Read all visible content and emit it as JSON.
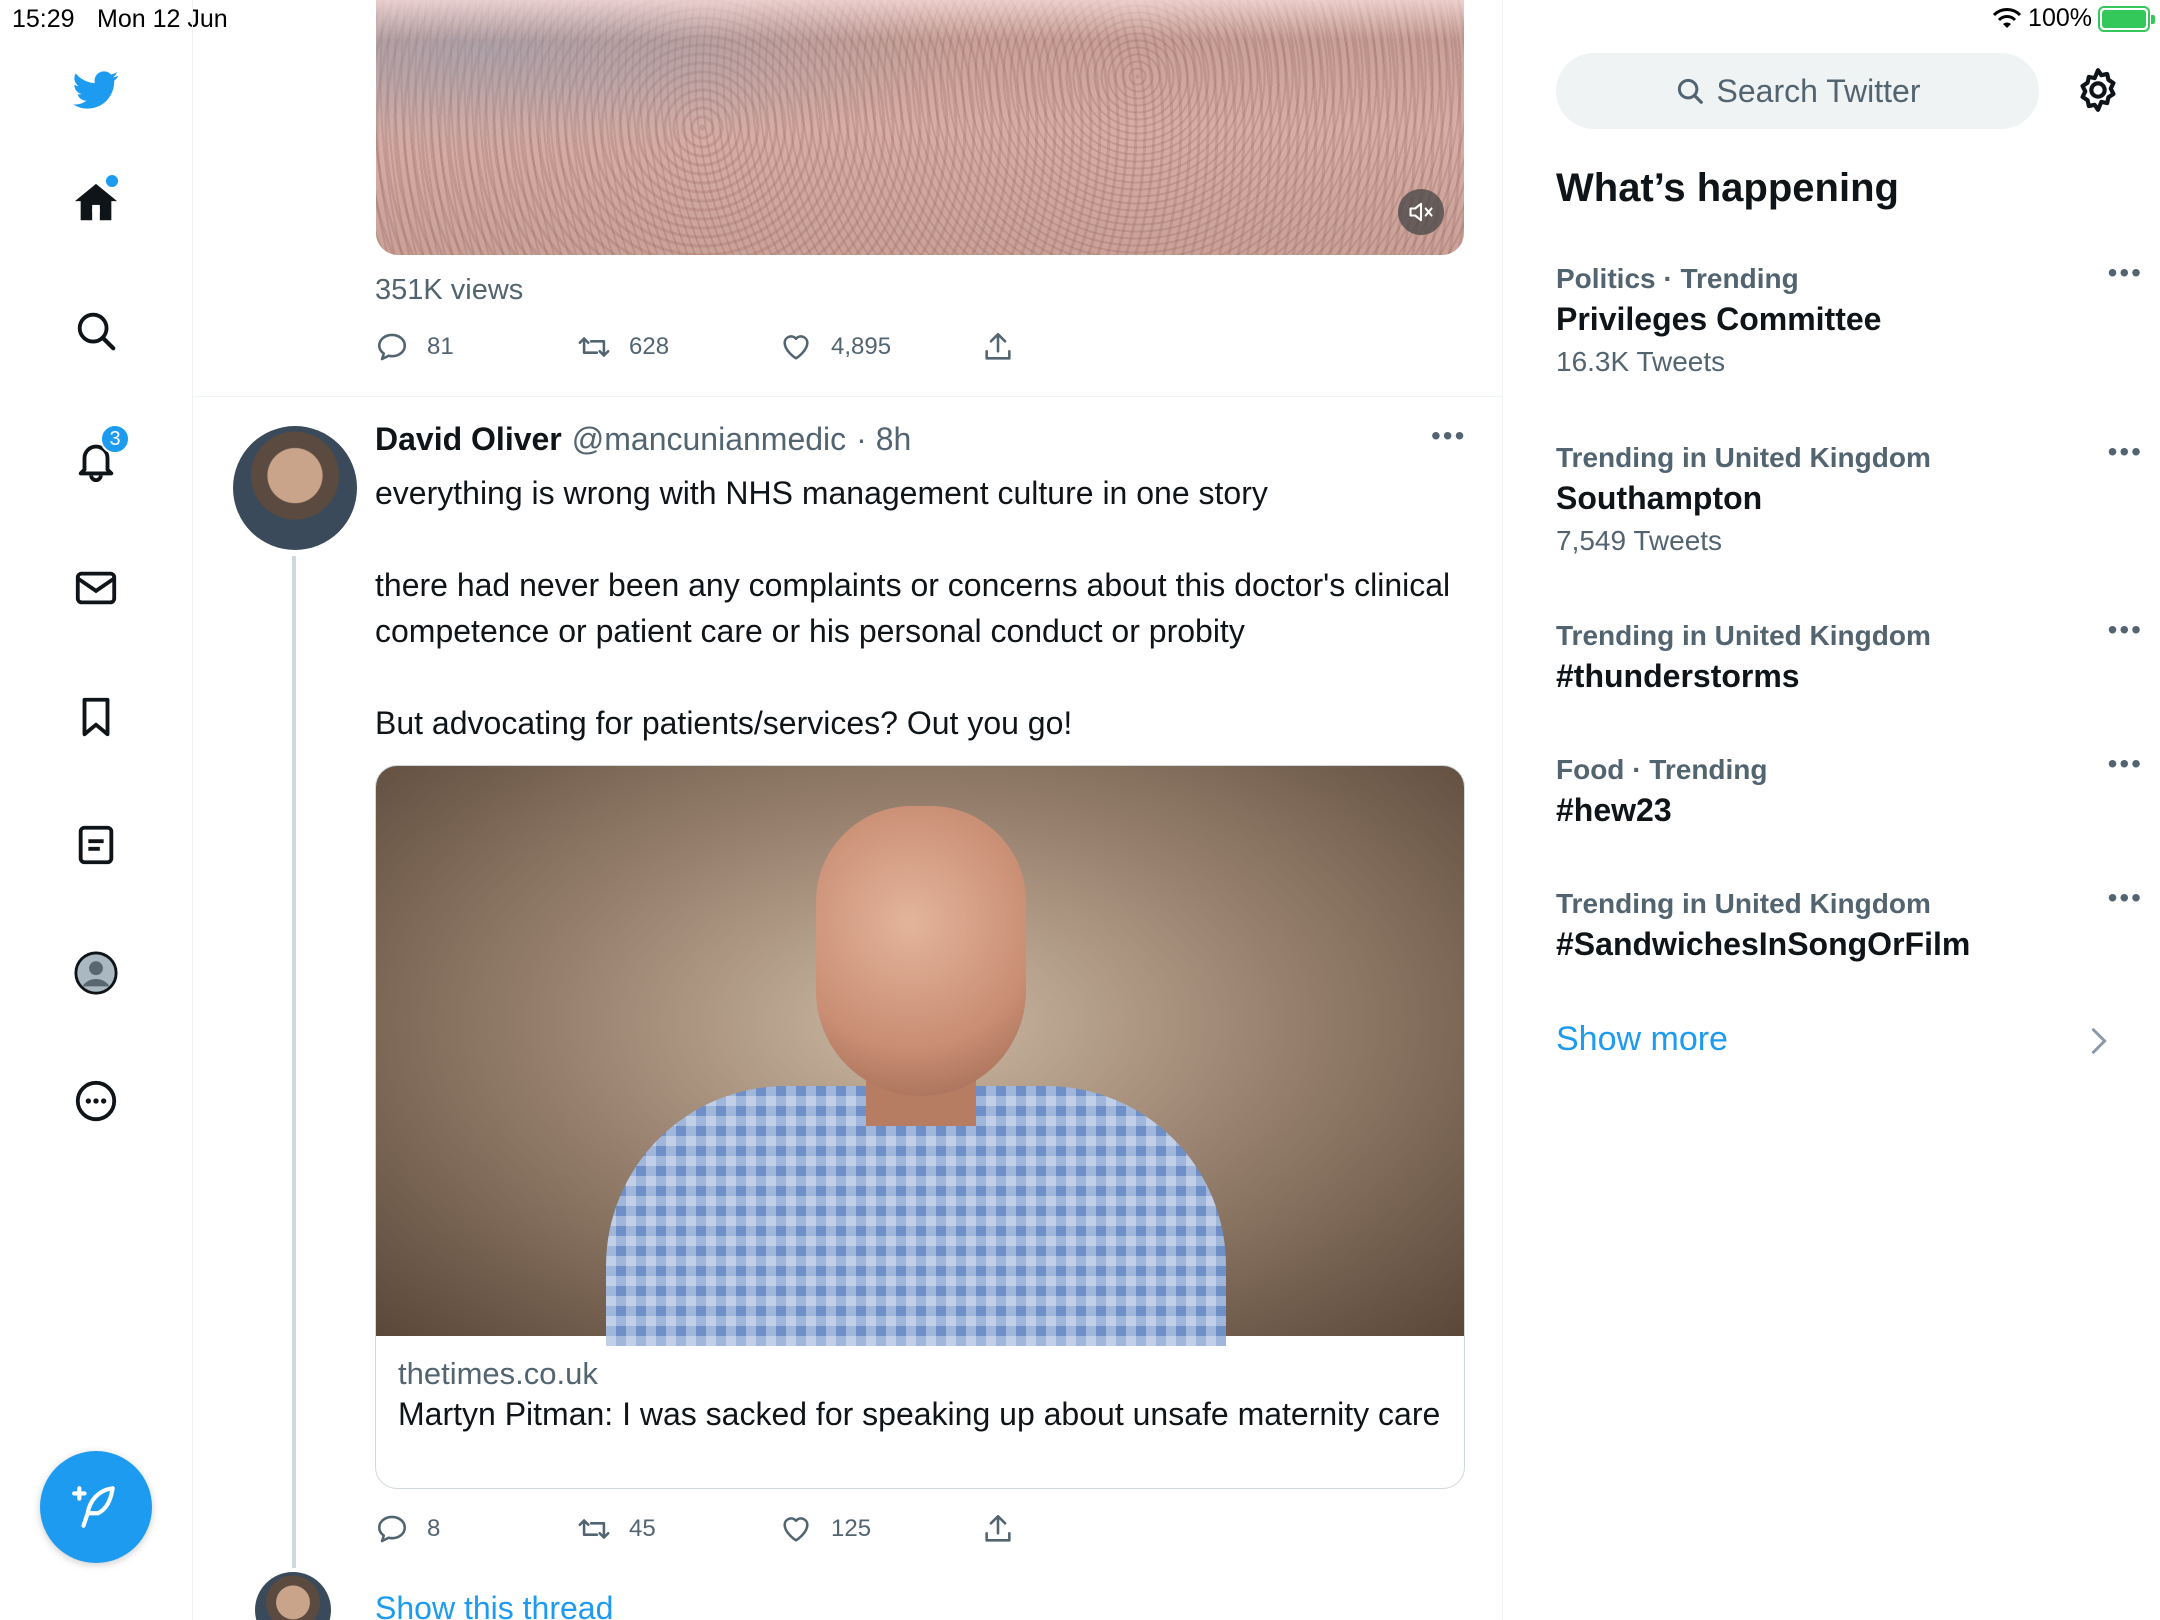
{
  "status_bar": {
    "time": "15:29",
    "date": "Mon 12 Jun",
    "battery": "100%"
  },
  "nav": {
    "notifications_badge": "3",
    "items": [
      "twitter-logo",
      "home",
      "explore",
      "notifications",
      "messages",
      "bookmarks",
      "lists",
      "profile",
      "more"
    ]
  },
  "video_tweet": {
    "views": "351K views",
    "replies": "81",
    "retweets": "628",
    "likes": "4,895"
  },
  "tweet": {
    "author_name": "David Oliver",
    "handle": "@mancunianmedic",
    "time": "· 8h",
    "text": "everything is wrong with NHS management culture in one story\n\nthere had never been any complaints or concerns about this doctor's clinical competence or patient care or his personal conduct or probity\n\nBut advocating for patients/services? Out you go!",
    "card_domain": "thetimes.co.uk",
    "card_title": "Martyn Pitman: I was sacked for speaking up about unsafe maternity care",
    "replies": "8",
    "retweets": "45",
    "likes": "125",
    "show_thread": "Show this thread"
  },
  "right": {
    "search_placeholder": "Search Twitter",
    "section_title": "What’s happening",
    "trends": [
      {
        "context": "Politics · Trending",
        "topic": "Privileges Committee",
        "count": "16.3K Tweets"
      },
      {
        "context": "Trending in United Kingdom",
        "topic": "Southampton",
        "count": "7,549 Tweets"
      },
      {
        "context": "Trending in United Kingdom",
        "topic": "#thunderstorms",
        "count": ""
      },
      {
        "context": "Food · Trending",
        "topic": "#hew23",
        "count": ""
      },
      {
        "context": "Trending in United Kingdom",
        "topic": "#SandwichesInSongOrFilm",
        "count": ""
      }
    ],
    "show_more": "Show more"
  },
  "colors": {
    "accent": "#1d9bf0",
    "text": "#0f1419",
    "muted": "#536471",
    "border": "#eff3f4"
  }
}
